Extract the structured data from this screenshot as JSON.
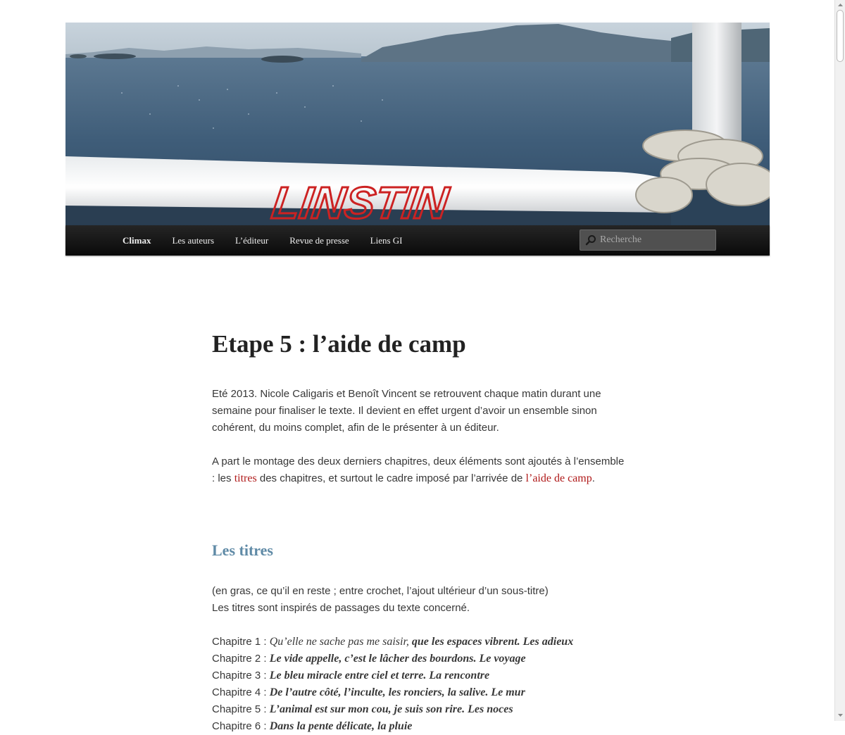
{
  "nav": {
    "items": [
      {
        "label": "Climax",
        "current": true
      },
      {
        "label": "Les auteurs"
      },
      {
        "label": "L’éditeur"
      },
      {
        "label": "Revue de presse"
      },
      {
        "label": "Liens GI"
      }
    ],
    "search_placeholder": "Recherche"
  },
  "banner": {
    "logo_text": "LINSTIN",
    "icon": "banner-photo"
  },
  "post": {
    "title": "Etape 5 : l’aide de camp",
    "para1": "Eté 2013. Nicole Caligaris et Benoît Vincent se retrouvent chaque matin durant une semaine pour finaliser le texte. Il devient en effet urgent d’avoir un ensemble sinon cohérent, du moins complet, afin de le présenter à un éditeur.",
    "para2_a": "A part le montage des deux derniers chapitres, deux éléments sont ajoutés à l’ensemble : les ",
    "para2_link1": "titres",
    "para2_b": " des chapitres, et surtout le cadre imposé par l’arrivée de ",
    "para2_link2": "l’aide de camp",
    "para2_c": ".",
    "section_title": "Les titres",
    "para3_line1": "(en gras, ce qu’il en reste ; entre crochet, l’ajout ultérieur d’un sous-titre)",
    "para3_line2": "Les titres sont inspirés de passages du texte concerné.",
    "chapters": [
      {
        "prefix": "Chapitre 1 : ",
        "italic": "Qu’elle ne sache pas me saisir, ",
        "bold": "que les espaces vibrent. Les adieux"
      },
      {
        "prefix": "Chapitre 2 : ",
        "italic": "",
        "bold": "Le vide appelle, c’est le lâcher des bourdons. Le voyage"
      },
      {
        "prefix": "Chapitre 3 : ",
        "italic": "",
        "bold": "Le bleu miracle entre ciel et terre. La rencontre"
      },
      {
        "prefix": "Chapitre 4 : ",
        "italic": "",
        "bold": "De l’autre côté, l’inculte, les ronciers, la salive. Le mur"
      },
      {
        "prefix": "Chapitre 5 : ",
        "italic": "",
        "bold": "L’animal est sur mon cou, je suis son rire. Les noces"
      },
      {
        "prefix": "Chapitre 6 : ",
        "italic": "",
        "bold": "Dans la pente délicate, la pluie"
      }
    ]
  },
  "colors": {
    "link": "#b01a1a",
    "section_heading": "#5f8aa6",
    "nav_bg": "#1a1a1a"
  }
}
